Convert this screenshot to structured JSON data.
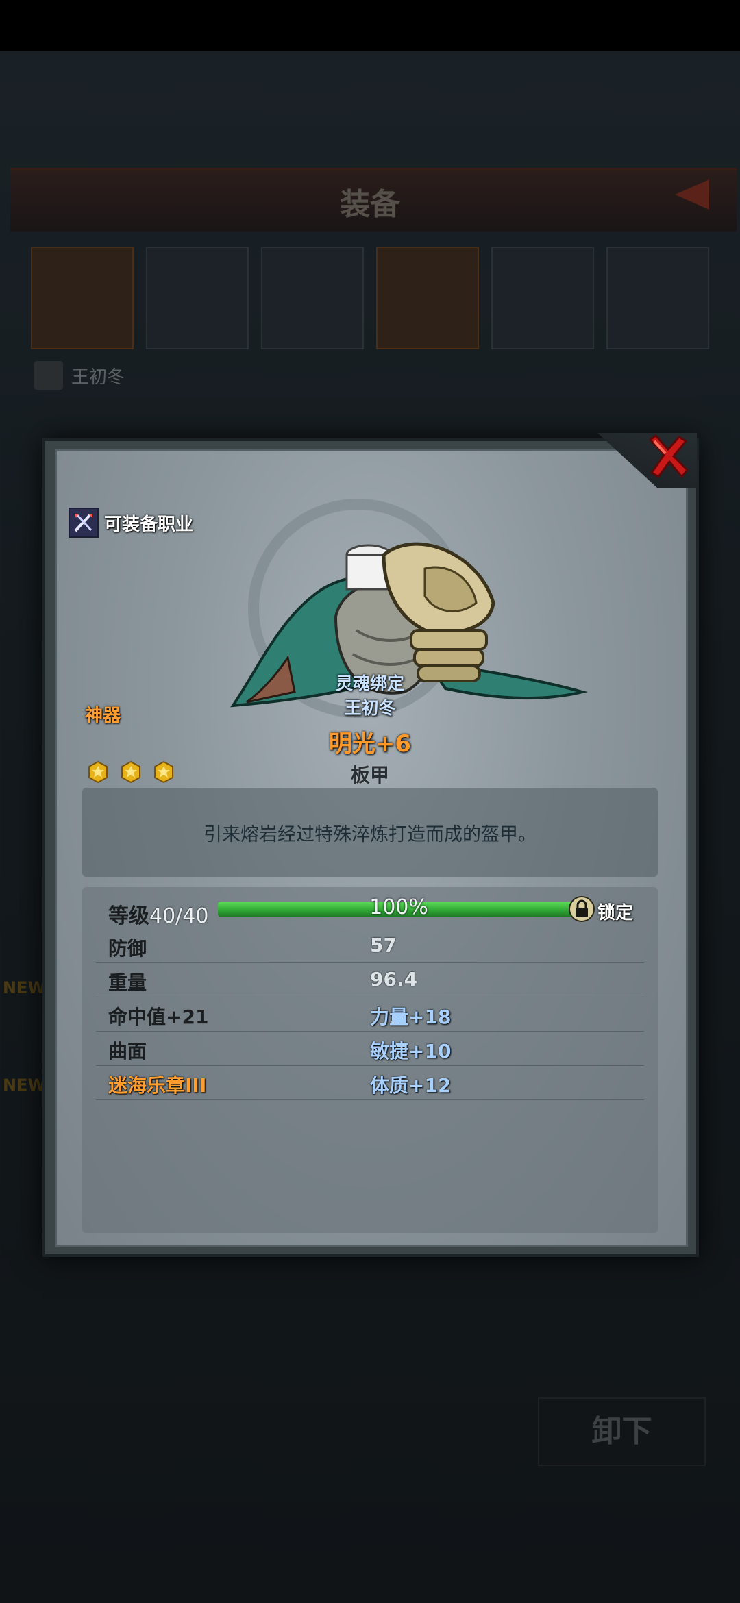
{
  "background": {
    "title": "装备",
    "owner_name": "王初冬",
    "bottom_button": "卸下",
    "new_badge": "NEW"
  },
  "dialog": {
    "job_label": "可装备职业",
    "rarity": "神器",
    "soul_bound": "灵魂绑定",
    "bound_owner": "王初冬",
    "item_name": "明光+6",
    "item_type": "板甲",
    "description": "引来熔岩经过特殊淬炼打造而成的盔甲。",
    "star_count": 3,
    "level": {
      "label": "等级",
      "value": "40/40",
      "progress_text": "100%",
      "progress": 1.0,
      "lock_label": "锁定"
    },
    "stats": [
      {
        "left": "防御",
        "right": "57"
      },
      {
        "left": "重量",
        "right": "96.4"
      },
      {
        "left": "命中值+21",
        "right": "力量+18"
      },
      {
        "left": "曲面",
        "right": "敏捷+10"
      },
      {
        "left": "迷海乐章III",
        "right": "体质+12"
      }
    ]
  },
  "colors": {
    "rarity": "#ff9e2e",
    "bonus_stat": "#a8d0ff",
    "progress": "#2fa634",
    "close": "#d41c1c"
  },
  "icons": {
    "close": "close-x-icon",
    "job": "crossed-weapons-icon",
    "star": "gold-star-icon",
    "lock": "lock-icon",
    "item": "plate-armor-icon"
  }
}
